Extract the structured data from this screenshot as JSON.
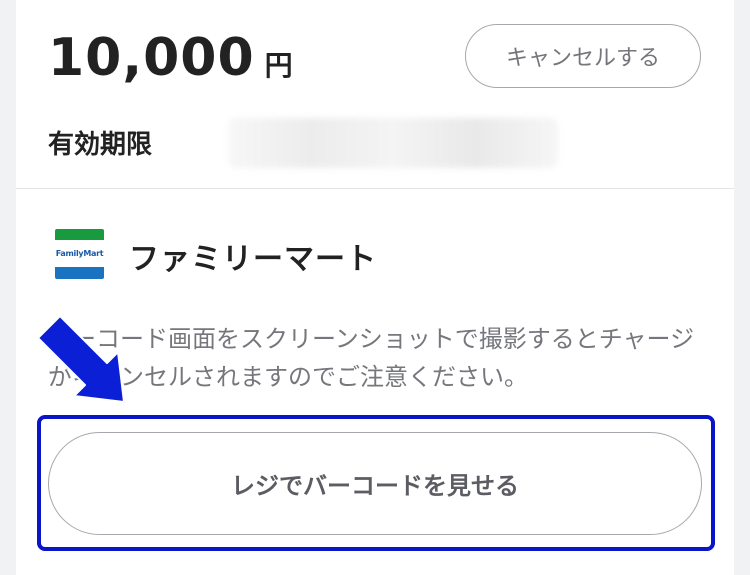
{
  "amount": {
    "value": "10,000",
    "unit": "円"
  },
  "cancel_button": {
    "label": "キャンセルする"
  },
  "expiry": {
    "label": "有効期限"
  },
  "store": {
    "logo_text": "FamilyMart",
    "name": "ファミリーマート"
  },
  "notice": {
    "text": "バーコード画面をスクリーンショットで撮影するとチャージがキャンセルされますのでご注意ください。"
  },
  "primary_button": {
    "label": "レジでバーコードを見せる"
  },
  "colors": {
    "highlight": "#0a14c8",
    "arrow": "#0a1fd6",
    "logo_green": "#1a9a3f",
    "logo_blue": "#1a73c0"
  },
  "icons": {
    "arrow": "down-right-arrow-icon"
  }
}
